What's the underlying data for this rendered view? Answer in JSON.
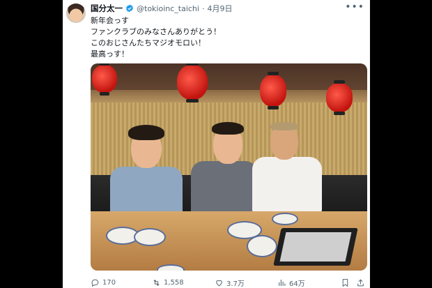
{
  "tweet": {
    "author_name": "国分太一",
    "handle": "@tokioinc_taichi",
    "separator": "·",
    "date": "4月9日",
    "text_lines": [
      "新年会っす",
      "ファンクラブのみなさんありがとう！",
      "このおじさんたちマジオモロい！",
      "最高っす！"
    ],
    "more_icon": "more-horizontal-icon"
  },
  "actions": {
    "replies": "170",
    "retweets": "1,558",
    "likes": "3.7万",
    "views": "64万"
  },
  "colors": {
    "background": "#000000",
    "card": "#ffffff",
    "verified": "#1d9bf0",
    "secondary_text": "#536471",
    "primary_text": "#0f1419"
  }
}
